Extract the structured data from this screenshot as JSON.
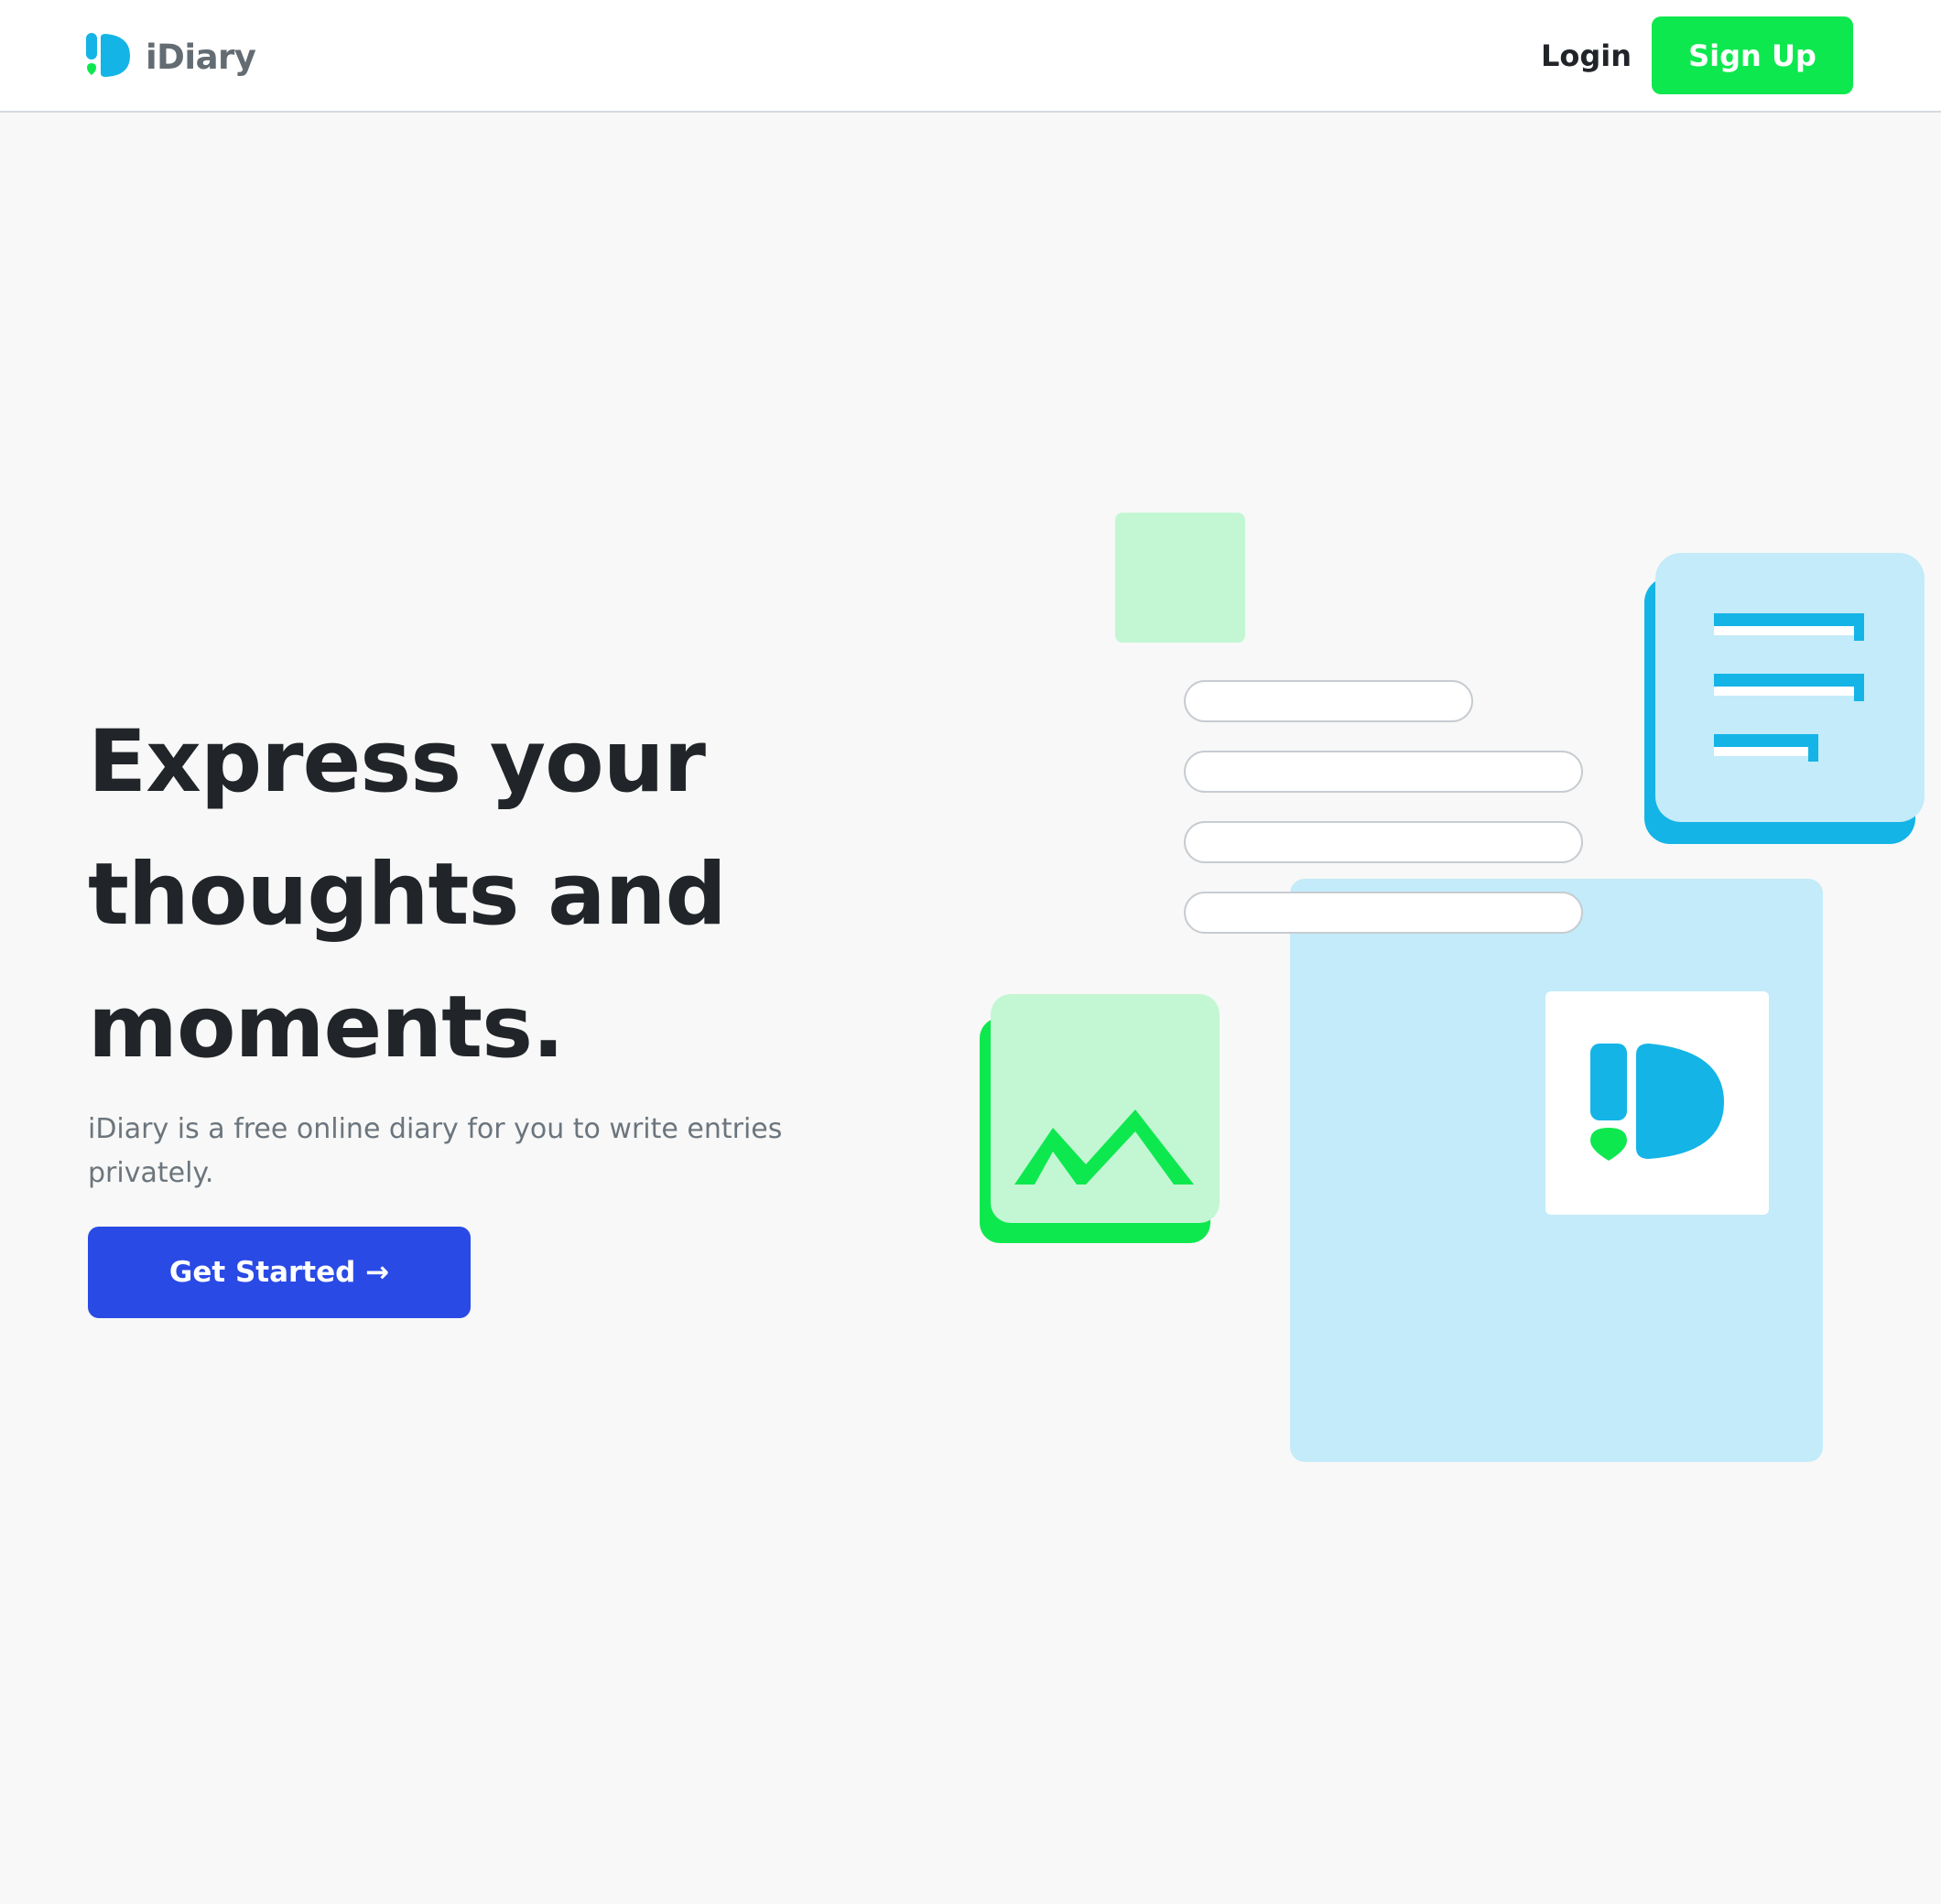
{
  "navbar": {
    "brand_name": "iDiary",
    "login_label": "Login",
    "signup_label": "Sign Up"
  },
  "hero": {
    "title": "Express your thoughts and moments.",
    "subtitle": "iDiary is a free online diary for you to write entries privately.",
    "cta_label": "Get Started →"
  },
  "colors": {
    "brand_blue": "#14b4e6",
    "brand_green": "#0ee84f",
    "cta_blue": "#2a4ae6",
    "light_blue": "#c3ebf9",
    "light_green": "#c3f7d4",
    "heading_text": "#212529",
    "muted_text": "#6c757d"
  },
  "icons": {
    "brand_logo": "idiary-logo-icon",
    "document": "document-lines-icon",
    "image": "mountain-image-icon"
  }
}
